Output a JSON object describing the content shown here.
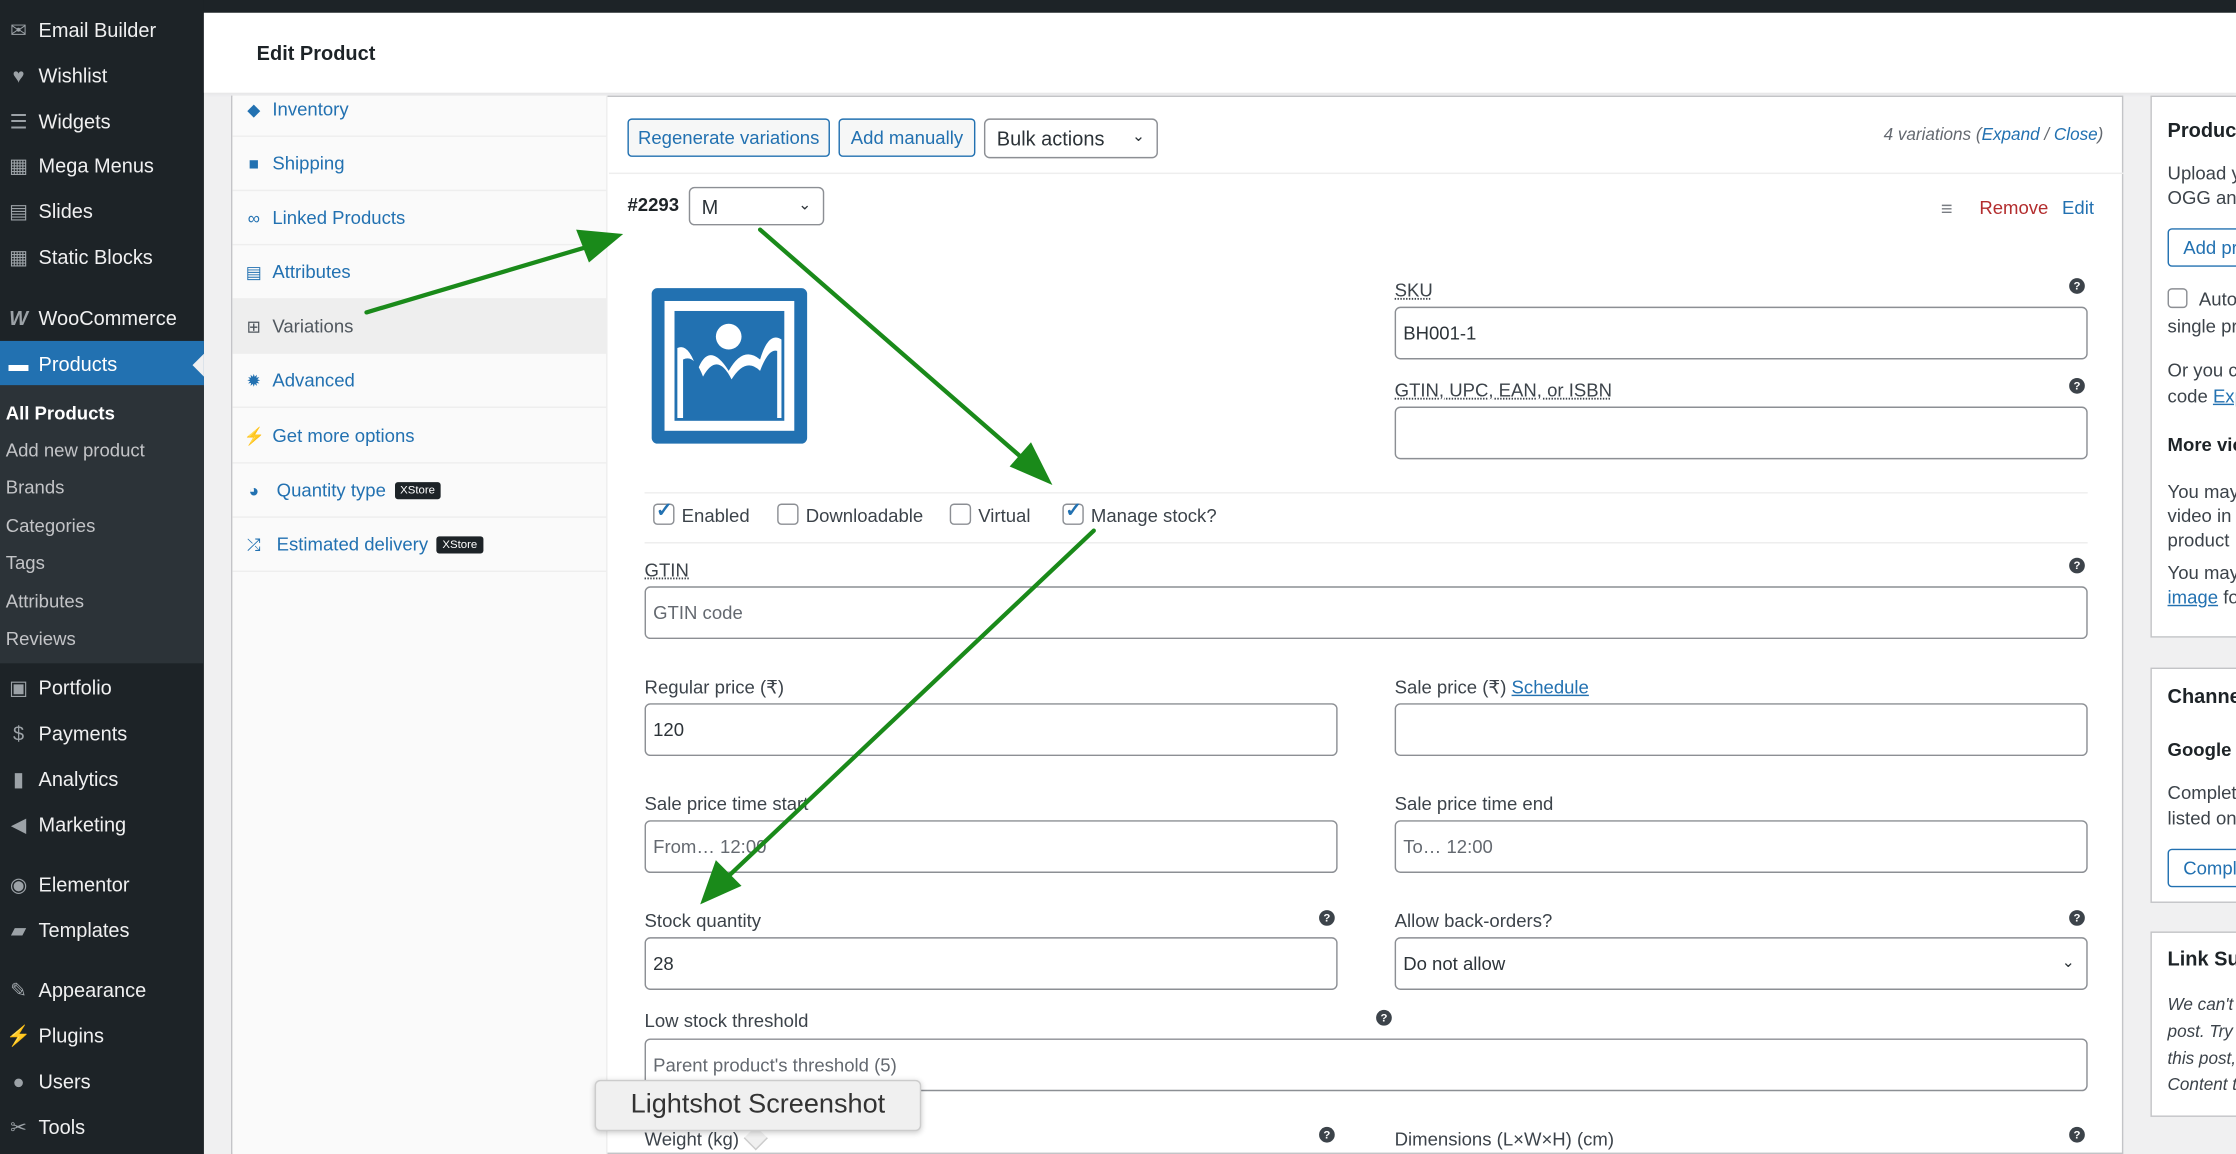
{
  "sidebar": {
    "items": [
      {
        "label": "Email Builder",
        "icon": "envelope-icon"
      },
      {
        "label": "Wishlist",
        "icon": "heart-icon"
      },
      {
        "label": "Widgets",
        "icon": "widgets-icon"
      },
      {
        "label": "Mega Menus",
        "icon": "grid-icon"
      },
      {
        "label": "Slides",
        "icon": "slides-icon"
      },
      {
        "label": "Static Blocks",
        "icon": "grid-icon"
      },
      {
        "label": "WooCommerce",
        "icon": "woo-icon"
      },
      {
        "label": "Products",
        "icon": "archive-icon"
      },
      {
        "label": "Portfolio",
        "icon": "portfolio-icon"
      },
      {
        "label": "Payments",
        "icon": "dollar-icon"
      },
      {
        "label": "Analytics",
        "icon": "bar-chart-icon"
      },
      {
        "label": "Marketing",
        "icon": "megaphone-icon"
      },
      {
        "label": "Elementor",
        "icon": "elementor-icon"
      },
      {
        "label": "Templates",
        "icon": "folder-icon"
      },
      {
        "label": "Appearance",
        "icon": "brush-icon"
      },
      {
        "label": "Plugins",
        "icon": "plug-icon"
      },
      {
        "label": "Users",
        "icon": "user-icon"
      },
      {
        "label": "Tools",
        "icon": "wrench-icon"
      }
    ],
    "submenu": [
      "All Products",
      "Add new product",
      "Brands",
      "Categories",
      "Tags",
      "Attributes",
      "Reviews"
    ]
  },
  "header": {
    "title": "Edit Product"
  },
  "tabs": [
    {
      "label": "Inventory",
      "icon": "tag-icon"
    },
    {
      "label": "Shipping",
      "icon": "truck-icon"
    },
    {
      "label": "Linked Products",
      "icon": "link-icon"
    },
    {
      "label": "Attributes",
      "icon": "list-icon"
    },
    {
      "label": "Variations",
      "icon": "grid-icon"
    },
    {
      "label": "Advanced",
      "icon": "gear-icon"
    },
    {
      "label": "Get more options",
      "icon": "plug-icon"
    },
    {
      "label": "Quantity type",
      "icon": "pie-icon",
      "badge": "XStore"
    },
    {
      "label": "Estimated delivery",
      "icon": "shuffle-icon",
      "badge": "XStore"
    }
  ],
  "toolbar": {
    "regenerate": "Regenerate variations",
    "add_manually": "Add manually",
    "bulk_actions": "Bulk actions",
    "variations_count": "4 variations",
    "expand": "Expand",
    "separator": "/",
    "close": "Close"
  },
  "variation": {
    "id": "#2293",
    "attribute_value": "M",
    "remove": "Remove",
    "edit": "Edit",
    "sku_label": "SKU",
    "sku_value": "BH001-1",
    "gtin_upc_label": "GTIN, UPC, EAN, or ISBN",
    "gtin_upc_value": "",
    "checkboxes": {
      "enabled": {
        "label": "Enabled",
        "checked": true
      },
      "downloadable": {
        "label": "Downloadable",
        "checked": false
      },
      "virtual": {
        "label": "Virtual",
        "checked": false
      },
      "manage_stock": {
        "label": "Manage stock?",
        "checked": true
      }
    },
    "gtin_label": "GTIN",
    "gtin_placeholder": "GTIN code",
    "regular_price_label": "Regular price (₹)",
    "regular_price_value": "120",
    "sale_price_label": "Sale price (₹)",
    "schedule_link": "Schedule",
    "sale_price_value": "",
    "sale_start_label": "Sale price time start",
    "sale_start_placeholder": "From… 12:00",
    "sale_end_label": "Sale price time end",
    "sale_end_placeholder": "To… 12:00",
    "stock_qty_label": "Stock quantity",
    "stock_qty_value": "28",
    "backorders_label": "Allow back-orders?",
    "backorders_value": "Do not allow",
    "low_stock_label": "Low stock threshold",
    "low_stock_placeholder": "Parent product's threshold (5)",
    "weight_label": "Weight (kg)",
    "dimensions_label": "Dimensions (L×W×H) (cm)"
  },
  "right_panels": {
    "product_video": {
      "title": "Product",
      "lines": [
        "Upload y",
        "OGG and"
      ],
      "button": "Add pr",
      "checkbox_label": "Auto",
      "checkbox_line2": "single pr",
      "or_line1": "Or you c",
      "or_line2": "code",
      "or_link": "Exp",
      "more_title": "More vic",
      "may1": [
        "You may",
        "video in",
        "product"
      ],
      "may2_line1": "You may",
      "may2_link": "image",
      "may2_after": "fo"
    },
    "channels": {
      "title": "Channe",
      "subtitle": "Google f",
      "lines": [
        "Complet",
        "listed on"
      ],
      "button": "Compl"
    },
    "link_suggestions": {
      "title": "Link Sug",
      "lines": [
        "We can't",
        "post. Try",
        "this post,",
        "Content t"
      ]
    }
  },
  "tooltip": "Lightshot Screenshot",
  "colors": {
    "accent": "#2271b1",
    "arrow": "#1a8a1a",
    "remove": "#b32d2e",
    "sidebar_bg": "#1d2327"
  }
}
